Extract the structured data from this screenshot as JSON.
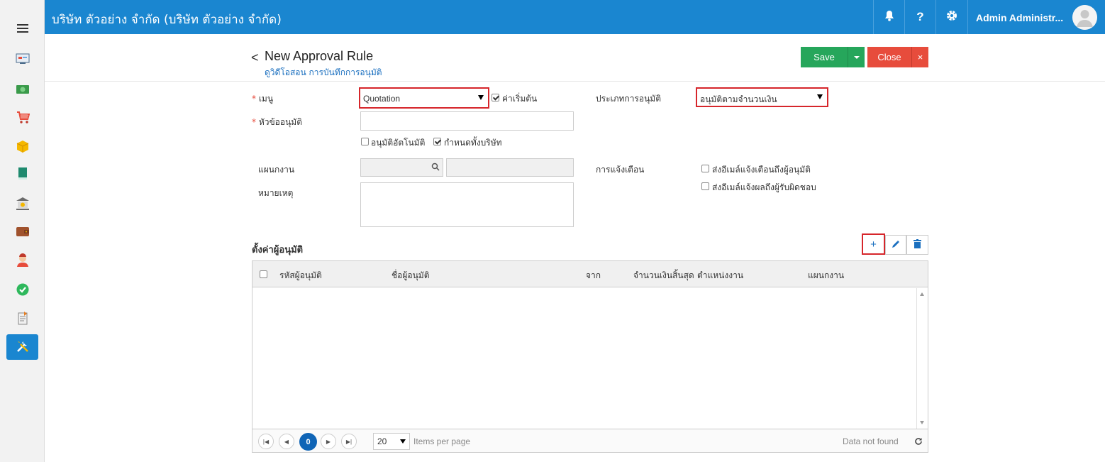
{
  "header": {
    "title": "บริษัท ตัวอย่าง จำกัด (บริษัท ตัวอย่าง จำกัด)",
    "help_label": "?",
    "user_name": "Admin Administr..."
  },
  "sidebar": {
    "items": [
      "hamburger-menu-icon",
      "dashboard-icon",
      "money-icon",
      "cart-icon",
      "box-icon",
      "book-icon",
      "bank-icon",
      "wallet-icon",
      "user-icon",
      "approve-icon",
      "report-icon",
      "tools-icon"
    ]
  },
  "page": {
    "back_label": "<",
    "title": "New Approval Rule",
    "subtitle": "ดูวิดีโอสอน การบันทึกการอนุมัติ",
    "save_label": "Save",
    "close_label": "Close",
    "close_x": "×"
  },
  "form": {
    "menu_label": "เมนู",
    "menu_value": "Quotation",
    "default_label": "ค่าเริ่มต้น",
    "approval_type_label": "ประเภทการอนุมัติ",
    "approval_type_value": "อนุมัติตามจำนวนเงิน",
    "subject_label": "หัวข้ออนุมัติ",
    "auto_approve_label": "อนุมัติอัตโนมัติ",
    "company_wide_label": "กำหนดทั้งบริษัท",
    "department_label": "แผนกงาน",
    "notify_label": "การแจ้งเตือน",
    "notify_approver_label": "ส่งอีเมล์แจ้งเตือนถึงผู้อนุมัติ",
    "notify_owner_label": "ส่งอีเมล์แจ้งผลถึงผู้รับผิดชอบ",
    "remark_label": "หมายเหตุ",
    "required_mark": "*"
  },
  "approvers": {
    "section_title": "ตั้งค่าผู้อนุมัติ",
    "add_label": "+",
    "columns": [
      "รหัสผู้อนุมัติ",
      "ชื่อผู้อนุมัติ",
      "จาก",
      "จำนวนเงินสิ้นสุด",
      "ตำแหน่งงาน",
      "แผนกงาน"
    ],
    "rows": [],
    "current_page": "0",
    "page_size": "20",
    "items_per_page_label": "Items per page",
    "empty_text": "Data not found"
  },
  "colors": {
    "brand": "#1a86d0",
    "save": "#26a65b",
    "close": "#e74c3c",
    "highlight": "#d6262b"
  }
}
